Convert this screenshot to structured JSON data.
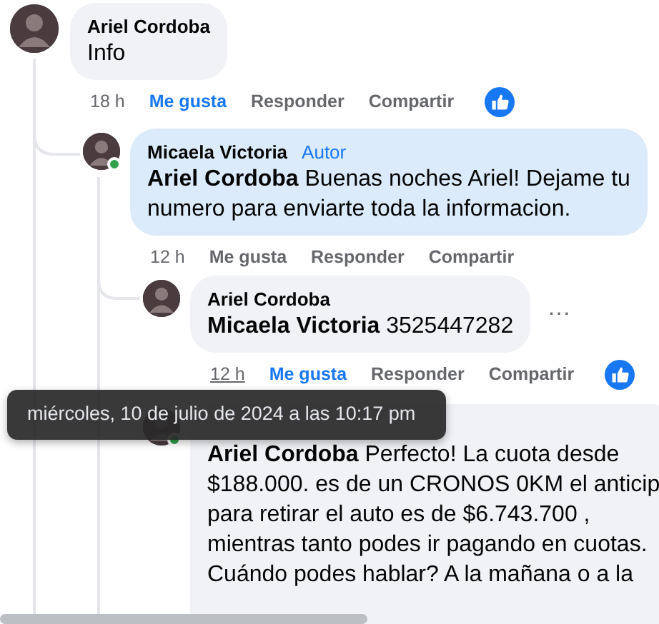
{
  "comments": [
    {
      "author": "Ariel Cordoba",
      "lines": [
        "Info"
      ],
      "time": "18 h",
      "time_hovered": false,
      "actions": [
        {
          "label": "Me gusta",
          "selected": true
        },
        {
          "label": "Responder",
          "selected": false
        },
        {
          "label": "Compartir",
          "selected": false
        }
      ],
      "has_reaction": true,
      "children": [
        {
          "author": "Micaela Victoria",
          "badge": "Autor",
          "lines": [
            "**Ariel Cordoba** Buenas noches Ariel! Dejame tu",
            "numero para enviarte toda la informacion."
          ],
          "online": true,
          "highlighted": true,
          "time": "12 h",
          "time_hovered": false,
          "actions": [
            {
              "label": "Me gusta",
              "selected": false
            },
            {
              "label": "Responder",
              "selected": false
            },
            {
              "label": "Compartir",
              "selected": false
            }
          ],
          "children": [
            {
              "author": "Ariel Cordoba",
              "lines": [
                "**Micaela Victoria** 3525447282"
              ],
              "more": "···",
              "time": "12 h",
              "time_hovered": true,
              "actions": [
                {
                  "label": "Me gusta",
                  "selected": true
                },
                {
                  "label": "Responder",
                  "selected": false
                },
                {
                  "label": "Compartir",
                  "selected": false
                }
              ],
              "has_reaction": true
            },
            {
              "lines": [
                "**Ariel Cordoba** Perfecto! La cuota desde",
                "$188.000. es de un CRONOS 0KM el anticip",
                "para retirar el auto es de $6.743.700 ,",
                "mientras tanto podes ir pagando en cuotas.",
                "Cuándo podes hablar? A la mañana o a la"
              ],
              "online": true
            }
          ]
        }
      ]
    }
  ],
  "tooltip": "miércoles, 10 de julio de 2024 a las 10:17 pm"
}
